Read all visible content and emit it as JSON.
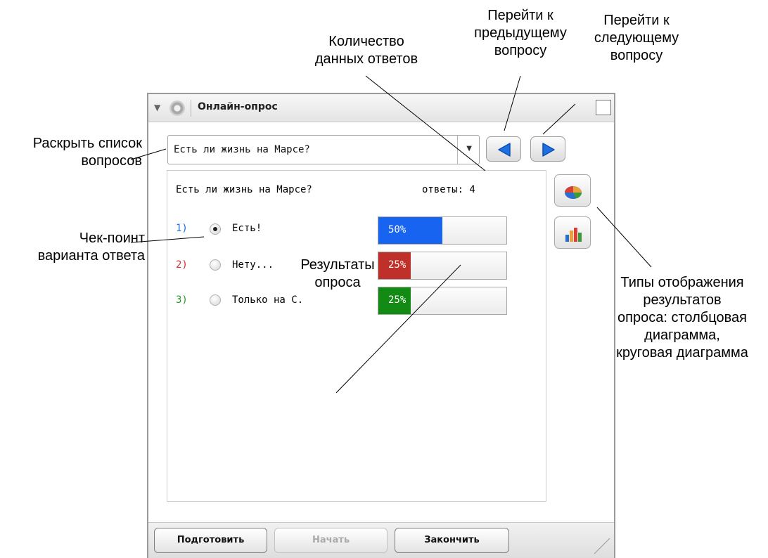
{
  "window": {
    "title": "Онлайн-опрос"
  },
  "question_select": {
    "value": "Есть ли жизнь на Марсе?"
  },
  "panel": {
    "question": "Есть ли жизнь на Марсе?",
    "answers_count": "ответы: 4",
    "options": [
      {
        "number": "1)",
        "label": "Есть!",
        "selected": true,
        "percent_label": "50%",
        "fraction": 0.5,
        "number_color": "#1a6ee0",
        "bar_color": "#1664f0"
      },
      {
        "number": "2)",
        "label": "Нету...",
        "selected": false,
        "percent_label": "25%",
        "fraction": 0.25,
        "number_color": "#d03030",
        "bar_color": "#c0302a"
      },
      {
        "number": "3)",
        "label": "Только на С.",
        "selected": false,
        "percent_label": "25%",
        "fraction": 0.25,
        "number_color": "#2a9a2a",
        "bar_color": "#138a13"
      }
    ]
  },
  "buttons": {
    "prepare": "Подготовить",
    "start": "Начать",
    "finish": "Закончить"
  },
  "annotations": {
    "answers_count": [
      "Количество",
      "данных ответов"
    ],
    "prev_question": [
      "Перейти к",
      "предыдущему",
      "вопросу"
    ],
    "next_question": [
      "Перейти к",
      "следующему",
      "вопросу"
    ],
    "expand_list": [
      "Раскрыть список",
      "вопросов"
    ],
    "checkpoint": [
      "Чек-поинт",
      "варианта ответа"
    ],
    "results": [
      "Результаты",
      "опроса"
    ],
    "display_types": [
      "Типы отображения",
      "результатов",
      "опроса: столбцовая",
      "диаграмма,",
      "круговая диаграмма"
    ]
  },
  "icons": {
    "titlebar": [
      "collapse-arrow-icon",
      "gear-icon",
      "maximize-icon"
    ],
    "nav": [
      "arrow-left-icon",
      "arrow-right-icon"
    ],
    "side": [
      "pie-chart-icon",
      "bar-chart-icon"
    ]
  }
}
